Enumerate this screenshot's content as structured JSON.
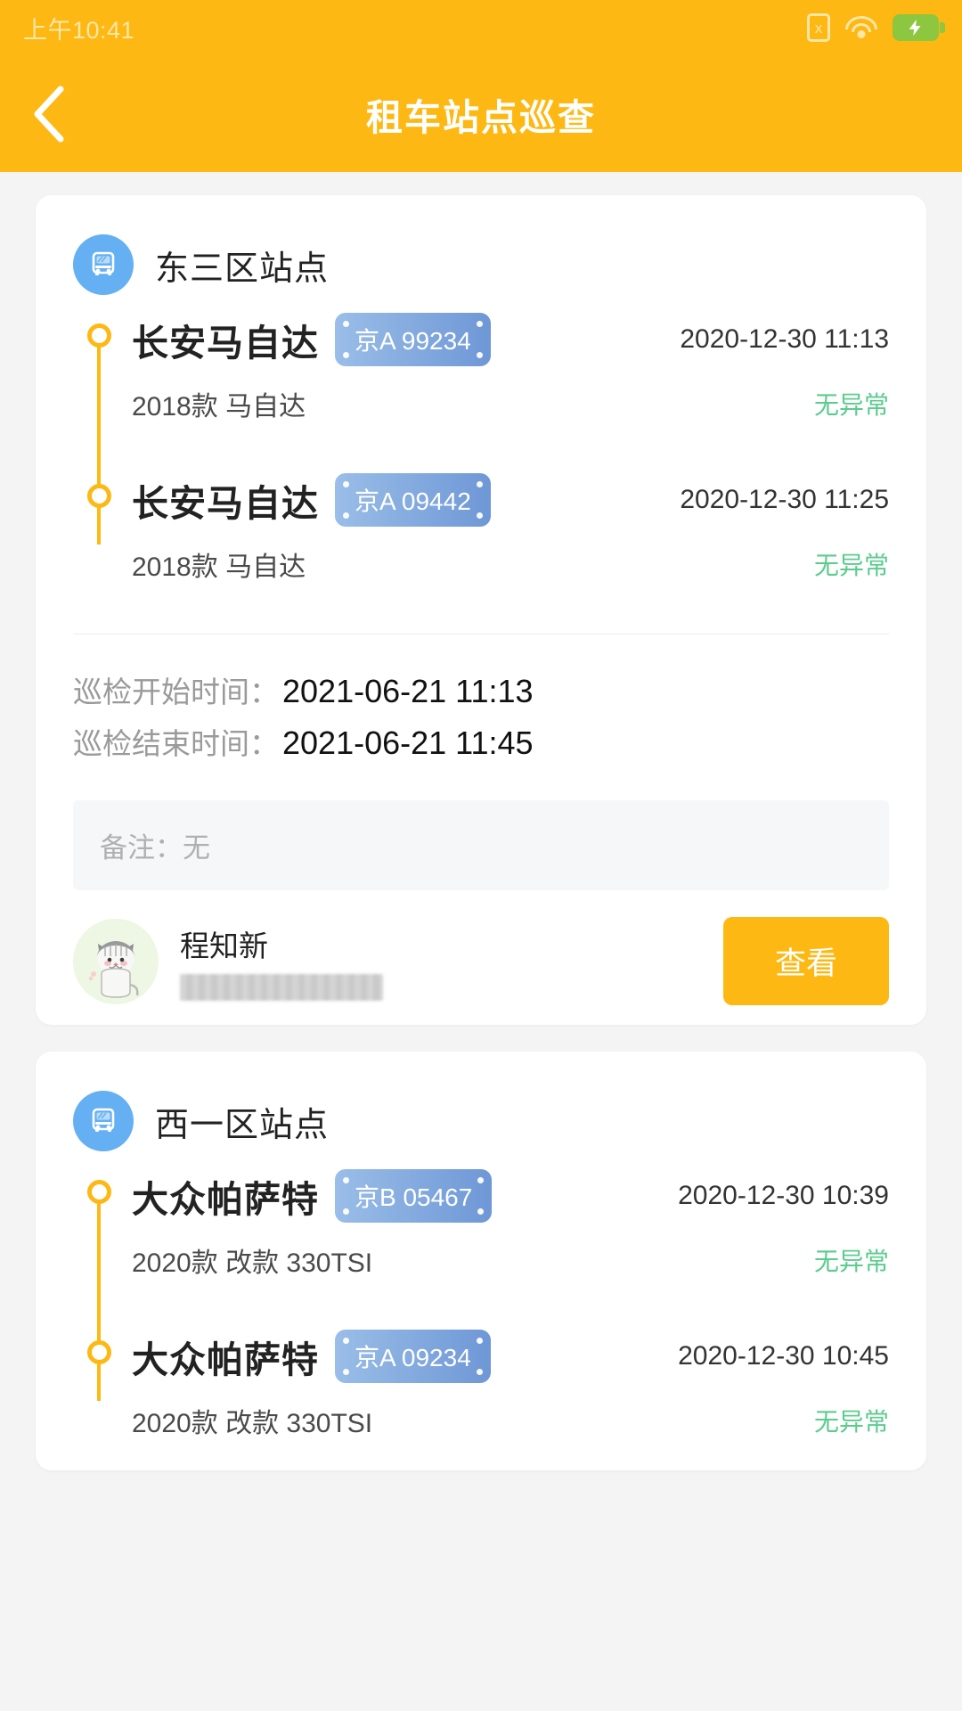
{
  "statusbar": {
    "time": "上午10:41",
    "sim_icon": "sim-card-x-icon",
    "sim_glyph": "x",
    "wifi_icon": "wifi-icon",
    "battery_icon": "battery-charging-icon",
    "battery_color": "#8DC63F",
    "text_color": "#ffe7a8"
  },
  "navbar": {
    "title": "租车站点巡查",
    "back_icon": "back-chevron-icon",
    "background": "#FDB813"
  },
  "theme": {
    "accent": "#FDB813",
    "station_icon_bg": "#64B0F2",
    "plate_from": "#9ABEE8",
    "plate_to": "#6E97D6",
    "status_ok": "#5CCC8E",
    "page_bg": "#f4f4f4"
  },
  "cards": [
    {
      "station": {
        "name": "东三区站点",
        "icon": "bus-station-icon"
      },
      "vehicles": [
        {
          "name": "长安马自达",
          "plate": "京A 99234",
          "time": "2020-12-30 11:13",
          "subtitle": "2018款 马自达",
          "status": "无异常"
        },
        {
          "name": "长安马自达",
          "plate": "京A 09442",
          "time": "2020-12-30 11:25",
          "subtitle": "2018款 马自达",
          "status": "无异常"
        }
      ],
      "inspection": {
        "start_label": "巡检开始时间：",
        "start_value": "2021-06-21 11:13",
        "end_label": "巡检结束时间：",
        "end_value": "2021-06-21 11:45"
      },
      "remark": "备注：无",
      "footer": {
        "avatar_icon": "cat-avatar-icon",
        "user_name": "程知新",
        "user_phone_masked": "",
        "button_label": "查看"
      }
    },
    {
      "station": {
        "name": "西一区站点",
        "icon": "bus-station-icon"
      },
      "vehicles": [
        {
          "name": "大众帕萨特",
          "plate": "京B 05467",
          "time": "2020-12-30 10:39",
          "subtitle": "2020款 改款 330TSI",
          "status": "无异常"
        },
        {
          "name": "大众帕萨特",
          "plate": "京A 09234",
          "time": "2020-12-30 10:45",
          "subtitle": "2020款 改款 330TSI",
          "status": "无异常"
        }
      ]
    }
  ]
}
